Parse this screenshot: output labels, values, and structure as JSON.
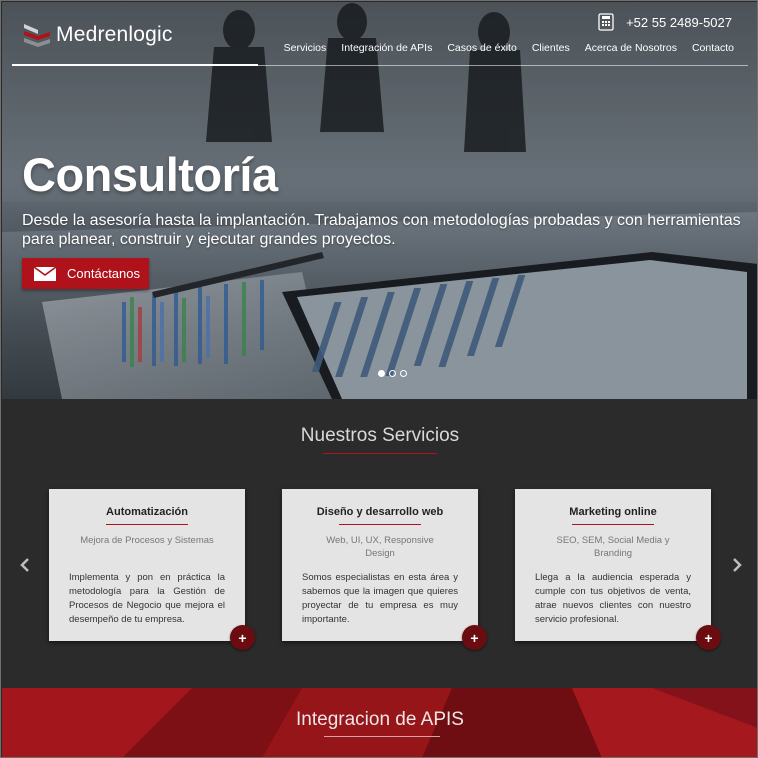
{
  "brand": {
    "name": "Medrenlogic"
  },
  "header": {
    "phone": "+52 55 2489-5027",
    "nav": [
      "Servicios",
      "Integración de APIs",
      "Casos de éxito",
      "Clientes",
      "Acerca de Nosotros",
      "Contacto"
    ]
  },
  "hero": {
    "title": "Consultoría",
    "subtitle": "Desde la asesoría hasta la implantación. Trabajamos con metodologías probadas y con herramientas para planear, construir y ejecutar grandes proyectos.",
    "cta_label": "Contáctanos",
    "slides_total": 3,
    "slide_active": 1
  },
  "services": {
    "title": "Nuestros Servicios",
    "cards": [
      {
        "title": "Automatización",
        "subtitle": "Mejora de Procesos y Sistemas",
        "body": "Implementa y pon en práctica la metodología para la Gestión de Procesos de Negocio que mejora el desempeño de tu empresa.",
        "more": "+"
      },
      {
        "title": "Diseño y desarrollo web",
        "subtitle": "Web, UI, UX, Responsive Design",
        "body": "Somos especialistas en esta área y sabemos que la imagen que quieres proyectar de tu empresa es muy importante.",
        "more": "+"
      },
      {
        "title": "Marketing online",
        "subtitle": "SEO, SEM, Social Media y Branding",
        "body": "Llega a la audiencia esperada y cumple con tus objetivos de venta, atrae nuevos clientes con nuestro servicio profesional.",
        "more": "+"
      }
    ]
  },
  "apis": {
    "title": "Integracion de APIS"
  },
  "colors": {
    "accent": "#b0121b",
    "dark_bg": "#2b2b2b",
    "card_bg": "#e4e4e4",
    "plus_bg": "#6b0d10",
    "apis_bg": "#8e1418"
  },
  "icons": {
    "phone": "phone-icon",
    "mail": "envelope-icon",
    "prev": "chevron-left-icon",
    "next": "chevron-right-icon",
    "more": "plus-icon"
  }
}
